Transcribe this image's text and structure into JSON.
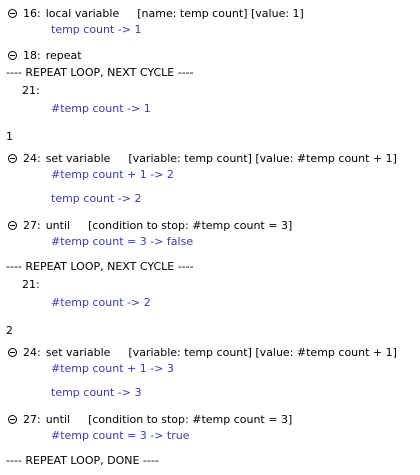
{
  "colors": {
    "value_text": "#3a3ab8",
    "text": "#000000",
    "background": "#ffffff"
  },
  "icons": {
    "collapse": "minus-circle-icon"
  },
  "trace": [
    {
      "line": "16:",
      "label": "local variable",
      "params": "[name: temp count] [value: 1]"
    },
    {
      "text": "temp count -> 1"
    },
    {
      "line": "18:",
      "label": "repeat"
    },
    {
      "text": "---- REPEAT LOOP, NEXT CYCLE ----"
    },
    {
      "text": "21:"
    },
    {
      "text": "#temp count -> 1"
    },
    {
      "text": "1"
    },
    {
      "line": "24:",
      "label": "set variable",
      "params": "[variable: temp count] [value: #temp count + 1]"
    },
    {
      "text": "#temp count + 1 -> 2"
    },
    {
      "text": "temp count -> 2"
    },
    {
      "line": "27:",
      "label": "until",
      "params": "[condition to stop: #temp count = 3]"
    },
    {
      "text": "#temp count = 3 -> false"
    },
    {
      "text": "---- REPEAT LOOP, NEXT CYCLE ----"
    },
    {
      "text": "21:"
    },
    {
      "text": "#temp count -> 2"
    },
    {
      "text": "2"
    },
    {
      "line": "24:",
      "label": "set variable",
      "params": "[variable: temp count] [value: #temp count + 1]"
    },
    {
      "text": "#temp count + 1 -> 3"
    },
    {
      "text": "temp count -> 3"
    },
    {
      "line": "27:",
      "label": "until",
      "params": "[condition to stop: #temp count = 3]"
    },
    {
      "text": "#temp count = 3 -> true"
    },
    {
      "text": "---- REPEAT LOOP, DONE ----"
    }
  ]
}
